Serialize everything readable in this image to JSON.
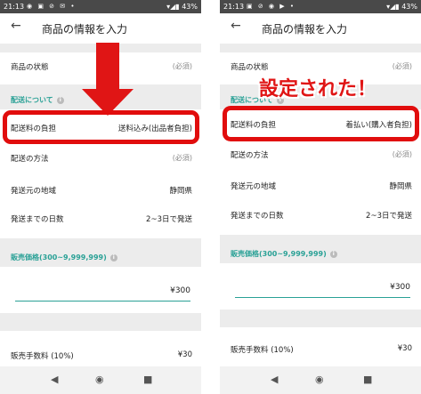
{
  "status": {
    "time": "21:13",
    "battery": "43%"
  },
  "appbar": {
    "back": "←",
    "title": "商品の情報を入力"
  },
  "rows": {
    "condition_label": "商品の状態",
    "condition_value": "(必須)",
    "shipping_section": "配送について",
    "fee_label": "配送料の負担",
    "method_label": "配送の方法",
    "method_value": "(必須)",
    "region_label": "発送元の地域",
    "region_value": "静岡県",
    "days_label": "発送までの日数",
    "days_value": "2~3日で発送",
    "price_section": "販売価格(300~9,999,999)",
    "price_value": "¥300",
    "commission_label": "販売手数料 (10%)",
    "commission_value": "¥30"
  },
  "left": {
    "fee_value": "送料込み(出品者負担)"
  },
  "right": {
    "fee_value": "着払い(購入者負担)"
  },
  "annotation": {
    "text": "設定された！"
  },
  "colors": {
    "accent": "#2aa196",
    "highlight": "#e10d0d"
  }
}
